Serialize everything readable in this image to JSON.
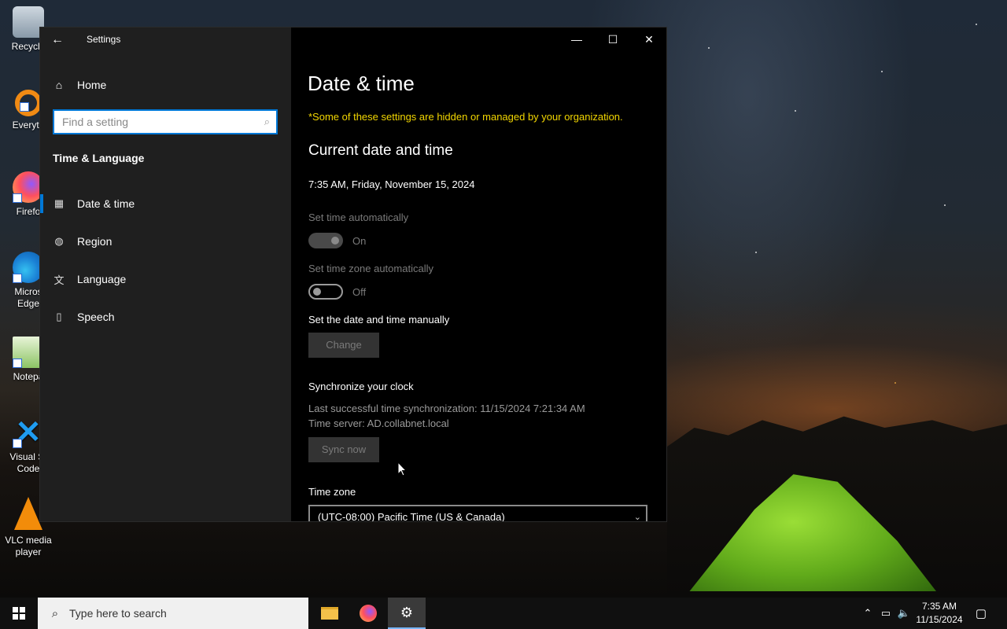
{
  "desktop": {
    "icons": [
      {
        "label": "Recycle",
        "icon": "recycle-bin-icon"
      },
      {
        "label": "Everyth",
        "icon": "everything-search-icon"
      },
      {
        "label": "Firefo",
        "icon": "firefox-icon"
      },
      {
        "label": "Micros\nEdge",
        "icon": "edge-icon"
      },
      {
        "label": "Notepa",
        "icon": "notepad-icon"
      },
      {
        "label": "Visual St\nCode",
        "icon": "vscode-icon"
      },
      {
        "label": "VLC media\nplayer",
        "icon": "vlc-icon"
      }
    ]
  },
  "window": {
    "title": "Settings",
    "back_icon": "back-arrow-icon",
    "minimize": "—",
    "maximize": "☐",
    "close": "✕"
  },
  "sidebar": {
    "home_label": "Home",
    "home_icon": "home-icon",
    "search_placeholder": "Find a setting",
    "search_icon": "search-icon",
    "section_title": "Time & Language",
    "items": [
      {
        "label": "Date & time",
        "icon": "calendar-clock-icon",
        "selected": true
      },
      {
        "label": "Region",
        "icon": "globe-icon",
        "selected": false
      },
      {
        "label": "Language",
        "icon": "language-icon",
        "selected": false
      },
      {
        "label": "Speech",
        "icon": "microphone-icon",
        "selected": false
      }
    ]
  },
  "content": {
    "title": "Date & time",
    "managed_notice": "*Some of these settings are hidden or managed by your organization.",
    "current_heading": "Current date and time",
    "current_value": "7:35 AM, Friday, November 15, 2024",
    "set_time_auto": {
      "label": "Set time automatically",
      "state": "On",
      "enabled": false
    },
    "set_tz_auto": {
      "label": "Set time zone automatically",
      "state": "Off",
      "enabled": true
    },
    "manual_label": "Set the date and time manually",
    "change_button": "Change",
    "sync_heading": "Synchronize your clock",
    "last_sync": "Last successful time synchronization: 11/15/2024 7:21:34 AM",
    "time_server": "Time server: AD.collabnet.local",
    "sync_button": "Sync now",
    "timezone_label": "Time zone",
    "timezone_value": "(UTC-08:00) Pacific Time (US & Canada)"
  },
  "taskbar": {
    "search_placeholder": "Type here to search",
    "apps": [
      {
        "name": "file-explorer-icon",
        "active": false
      },
      {
        "name": "firefox-icon",
        "active": false
      },
      {
        "name": "settings-gear-icon",
        "active": true
      }
    ],
    "clock_time": "7:35 AM",
    "clock_date": "11/15/2024"
  }
}
